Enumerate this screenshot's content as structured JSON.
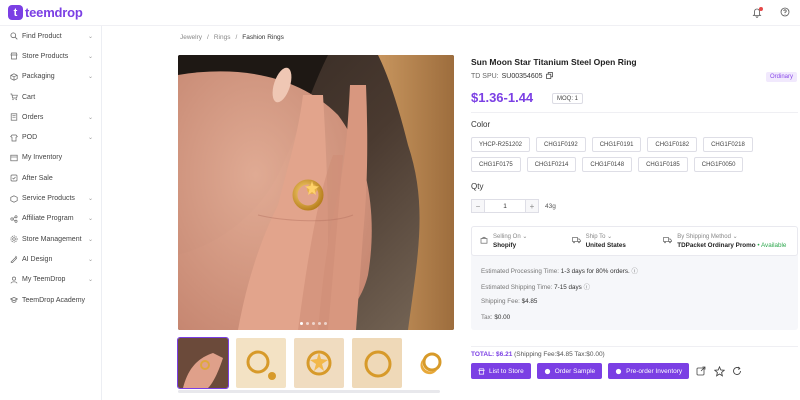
{
  "brand": {
    "logo_letter": "t",
    "name": "teemdrop"
  },
  "sidebar": {
    "items": [
      {
        "label": "Find Product",
        "icon": "search-icon",
        "has_children": true
      },
      {
        "label": "Store Products",
        "icon": "store-icon",
        "has_children": true
      },
      {
        "label": "Packaging",
        "icon": "package-icon",
        "has_children": true
      },
      {
        "label": "Cart",
        "icon": "cart-icon",
        "has_children": false
      },
      {
        "label": "Orders",
        "icon": "orders-icon",
        "has_children": true
      },
      {
        "label": "POD",
        "icon": "pod-icon",
        "has_children": true
      },
      {
        "label": "My Inventory",
        "icon": "inventory-icon",
        "has_children": false
      },
      {
        "label": "After Sale",
        "icon": "after-sale-icon",
        "has_children": false
      },
      {
        "label": "Service Products",
        "icon": "service-icon",
        "has_children": true
      },
      {
        "label": "Affiliate Program",
        "icon": "affiliate-icon",
        "has_children": true
      },
      {
        "label": "Store Management",
        "icon": "store-management-icon",
        "has_children": true
      },
      {
        "label": "AI Design",
        "icon": "ai-design-icon",
        "has_children": true
      },
      {
        "label": "My TeemDrop",
        "icon": "user-icon",
        "has_children": true
      },
      {
        "label": "TeemDrop Academy",
        "icon": "academy-icon",
        "has_children": false
      }
    ]
  },
  "breadcrumb": {
    "items": [
      "Jewelry",
      "Rings",
      "Fashion Rings"
    ],
    "separator": "/"
  },
  "product": {
    "title": "Sun Moon Star Titanium Steel Open Ring",
    "spu_label": "TD SPU:",
    "spu_value": "SU00354605",
    "badge": "Ordinary",
    "price": "$1.36-1.44",
    "moq": "MOQ: 1"
  },
  "color": {
    "label": "Color",
    "options": [
      "YHCP-R251202",
      "CHG1F0192",
      "CHG1F0191",
      "CHG1F0182",
      "CHG1F0218",
      "CHG1F0175",
      "CHG1F0214",
      "CHG1F0148",
      "CHG1F0185",
      "CHG1F0050"
    ]
  },
  "qty": {
    "label": "Qty",
    "value": "1",
    "minus": "−",
    "plus": "+",
    "weight": "43g"
  },
  "shipping": {
    "selling_on_label": "Selling On",
    "selling_on_value": "Shopify",
    "ship_to_label": "Ship To",
    "ship_to_value": "United States",
    "method_label": "By Shipping Method",
    "method_value": "TDPacket Ordinary Promo",
    "method_status": "• Available",
    "processing_label": "Estimated Processing Time:",
    "processing_value": "1-3 days for 80% orders.",
    "shipping_time_label": "Estimated Shipping Time:",
    "shipping_time_value": "7-15 days",
    "fee_label": "Shipping Fee:",
    "fee_value": "$4.85",
    "tax_label": "Tax:",
    "tax_value": "$0.00"
  },
  "summary": {
    "total_label": "TOTAL:",
    "total_value": "$6.21",
    "detail": "(Shipping Fee:$4.85  Tax:$0.00)"
  },
  "actions": {
    "list_to_store": "List to Store",
    "order_sample": "Order Sample",
    "preorder": "Pre-order Inventory"
  },
  "colors": {
    "accent": "#7b3fe4",
    "available": "#2fa84f",
    "badge_bg": "#f1e9fd"
  }
}
